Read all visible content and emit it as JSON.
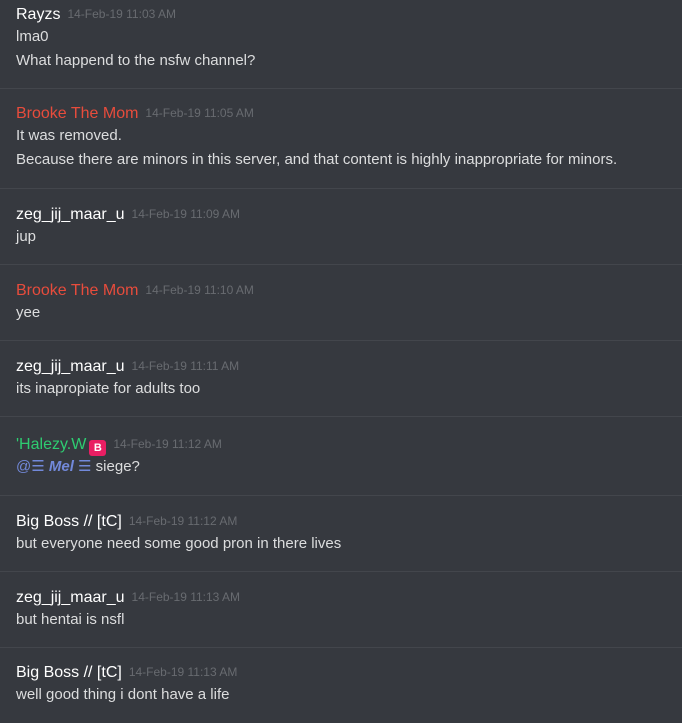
{
  "colors": {
    "background": "#36393f",
    "divider": "#43464c",
    "default_user": "#ffffff",
    "brooke": "#e74c3c",
    "halezy": "#2ecc71",
    "timestamp": "#686b70",
    "text": "#dcddde",
    "mention": "#7289da",
    "badge_bg": "#e91e63"
  },
  "messages": [
    {
      "author": "Rayzs",
      "timestamp": "14-Feb-19 11:03 AM",
      "lines": [
        "lma0",
        "What happend to the nsfw channel?"
      ]
    },
    {
      "author": "Brooke The Mom",
      "timestamp": "14-Feb-19 11:05 AM",
      "lines": [
        "It was removed.",
        "Because there are minors in this server, and that content is highly inappropriate for minors."
      ]
    },
    {
      "author": "zeg_jij_maar_u",
      "timestamp": "14-Feb-19 11:09 AM",
      "lines": [
        "jup"
      ]
    },
    {
      "author": "Brooke The Mom",
      "timestamp": "14-Feb-19 11:10 AM",
      "lines": [
        "yee"
      ]
    },
    {
      "author": "zeg_jij_maar_u",
      "timestamp": "14-Feb-19 11:11 AM",
      "lines": [
        "its inapropiate for adults too"
      ]
    },
    {
      "author": "'Halezy.W",
      "badge": "B",
      "badge_icon": "b-emoji-icon",
      "timestamp": "14-Feb-19 11:12 AM",
      "mention": {
        "prefix": "@☰",
        "name": "Mel",
        "suffix": "☰"
      },
      "mention_after_text": "siege?"
    },
    {
      "author": "Big Boss // [tC]",
      "timestamp": "14-Feb-19 11:12 AM",
      "lines": [
        "but everyone need some good pron in there lives"
      ]
    },
    {
      "author": "zeg_jij_maar_u",
      "timestamp": "14-Feb-19 11:13 AM",
      "lines": [
        "but hentai is nsfl"
      ]
    },
    {
      "author": "Big Boss // [tC]",
      "timestamp": "14-Feb-19 11:13 AM",
      "lines": [
        "well good thing i dont have a life"
      ]
    }
  ]
}
